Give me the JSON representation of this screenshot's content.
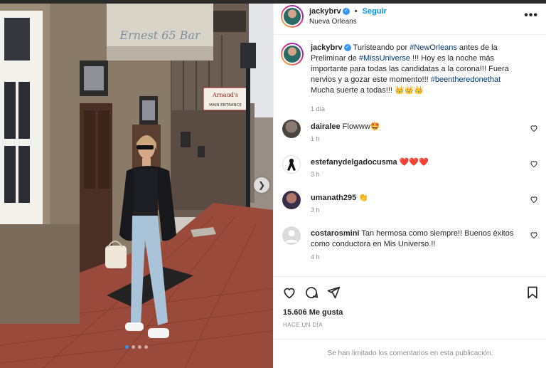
{
  "post": {
    "username": "jackybrv",
    "follow_label": "Seguir",
    "separator": "•",
    "location": "Nueva Orleans",
    "more_label": "•••",
    "carousel_position": {
      "current": 1,
      "total": 4
    },
    "photo_signs": {
      "bar_sign": "Ernest 65 Bar",
      "restaurant_sign_top": "Arnaud's",
      "restaurant_sign_bottom": "MAIN ENTRANCE"
    }
  },
  "caption": {
    "username": "jackybrv",
    "text_1": "Turisteando por ",
    "tag_1": "#NewOrleans",
    "text_2": " antes de la Preliminar de ",
    "tag_2": "#MissUniverse",
    "text_3": " !!! Hoy es la noche más importante para todas las candidatas a la corona!!! Fuera nervios y a gozar este momento!!! ",
    "tag_3": "#beentheredonethat",
    "text_4": " Mucha suerte a todas!!! 👑👑👑",
    "time": "1 día"
  },
  "comments": [
    {
      "username": "dairalee",
      "text": "Flowww🤩",
      "time": "1 h"
    },
    {
      "username": "estefanydelgadocusma",
      "text": "❤️❤️❤️",
      "time": "3 h"
    },
    {
      "username": "umanath295",
      "text": "👏",
      "time": "3 h"
    },
    {
      "username": "costarosmini",
      "text": "Tan hermosa como siempre!! Buenos éxitos como conductora en Mis Universo.!!",
      "time": "4 h"
    }
  ],
  "likes": {
    "count": "15.606",
    "label": "Me gusta"
  },
  "posted": "HACE UN DÍA",
  "footer_note": "Se han limitado los comentarios en esta publicación.",
  "colors": {
    "link_blue": "#0095f6",
    "hashtag": "#00376b",
    "meta_gray": "#8e8e8e",
    "verified": "#3897f0"
  },
  "icons": [
    "verified-badge-icon",
    "more-options-icon",
    "heart-icon",
    "comment-icon",
    "share-icon",
    "bookmark-icon",
    "chevron-right-icon"
  ]
}
